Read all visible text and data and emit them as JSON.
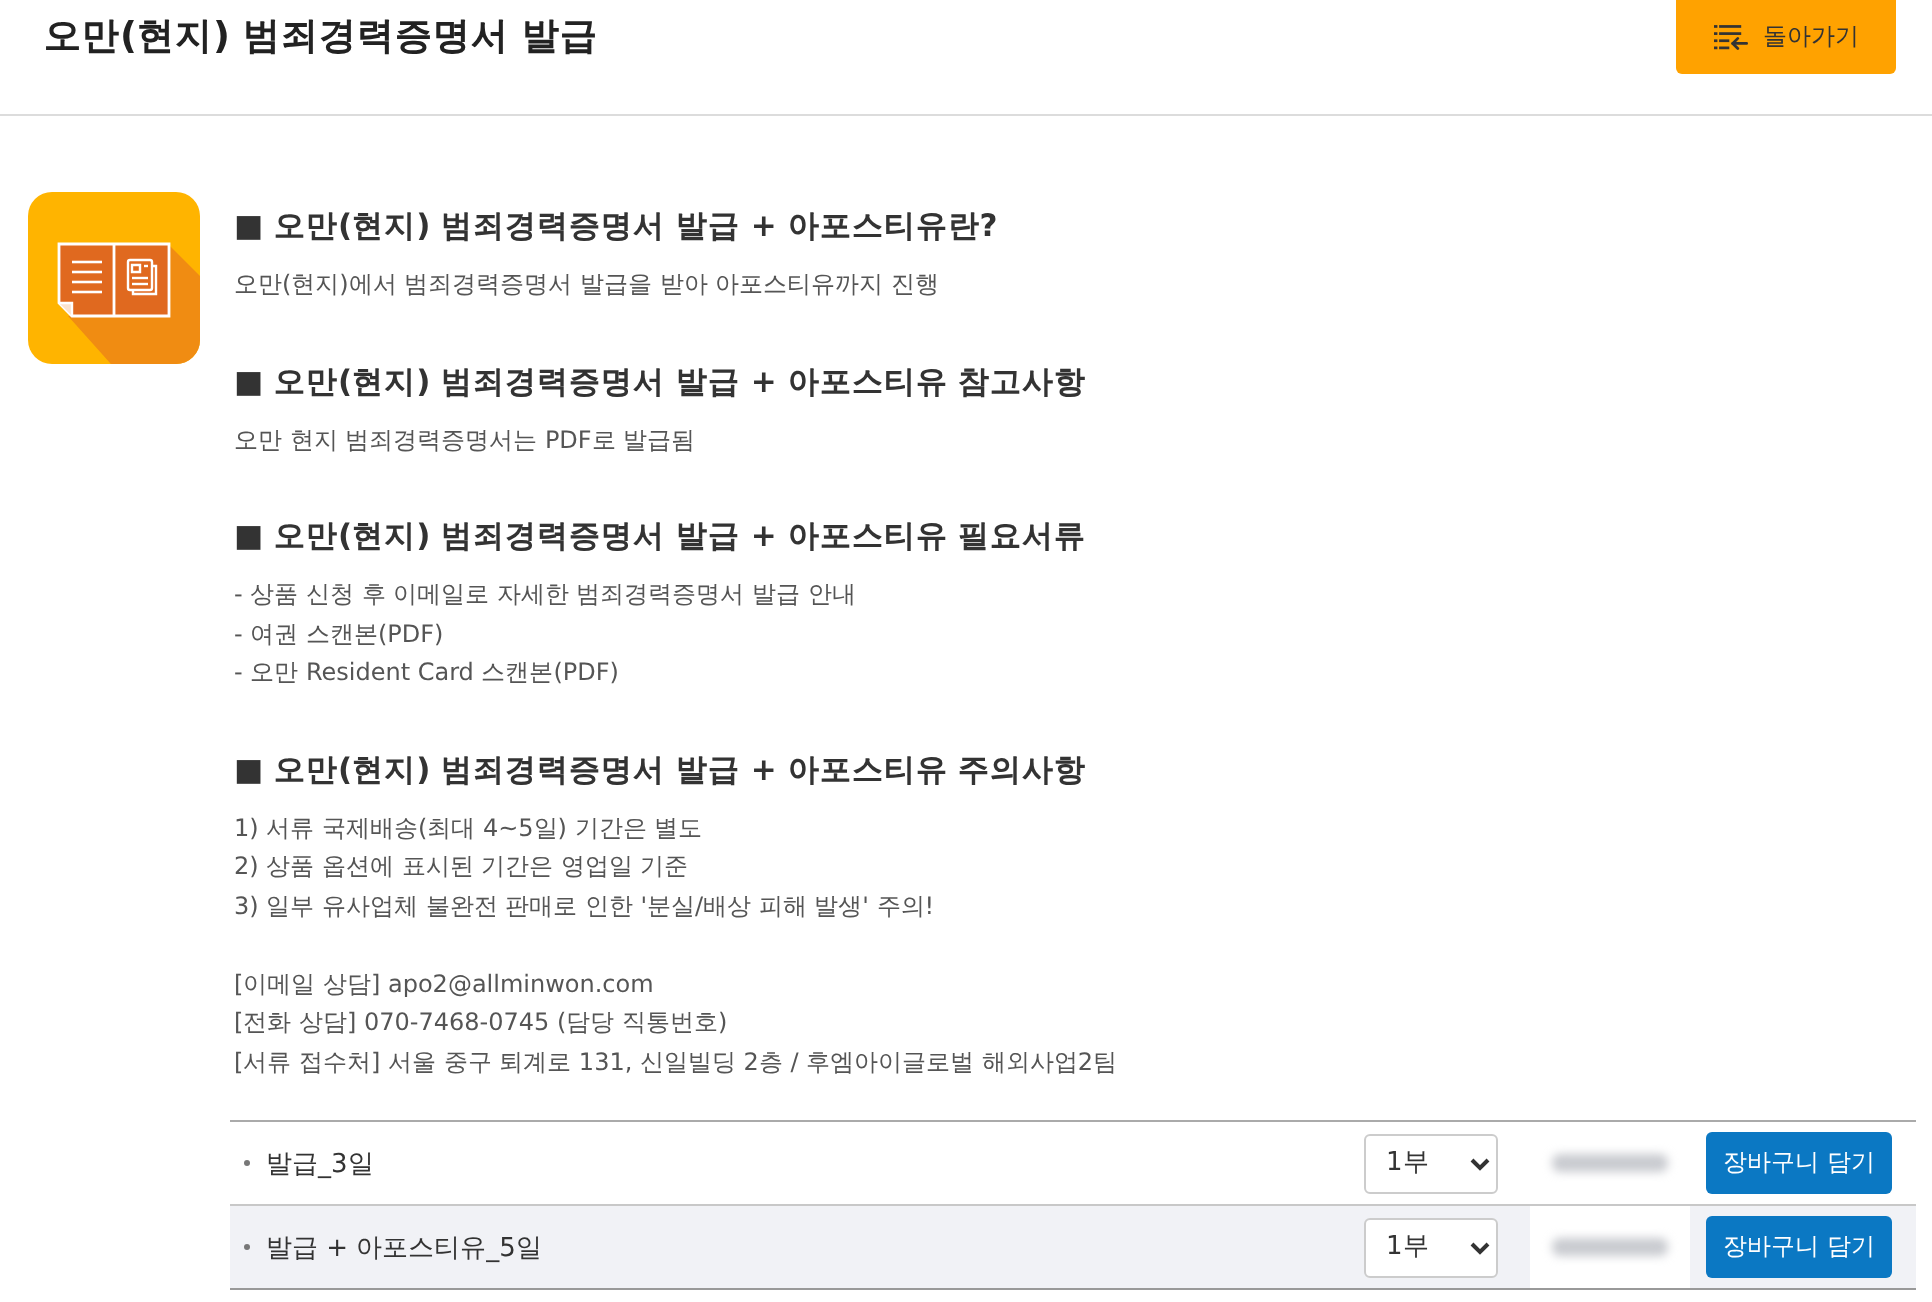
{
  "header": {
    "title": "오만(현지) 범죄경력증명서 발급",
    "back_button": "돌아가기"
  },
  "sections": [
    {
      "heading": "■ 오만(현지) 범죄경력증명서 발급 + 아포스티유란?",
      "paragraphs": [
        [
          "오만(현지)에서 범죄경력증명서 발급을 받아 아포스티유까지 진행"
        ]
      ]
    },
    {
      "heading": "■ 오만(현지) 범죄경력증명서 발급 + 아포스티유 참고사항",
      "paragraphs": [
        [
          "오만 현지 범죄경력증명서는 PDF로 발급됨"
        ]
      ]
    },
    {
      "heading": "■ 오만(현지) 범죄경력증명서 발급 + 아포스티유 필요서류",
      "paragraphs": [
        [
          "- 상품 신청 후 이메일로 자세한 범죄경력증명서 발급 안내",
          "- 여권 스캔본(PDF)",
          "- 오만 Resident Card 스캔본(PDF)"
        ]
      ]
    },
    {
      "heading": "■ 오만(현지) 범죄경력증명서 발급 + 아포스티유 주의사항",
      "paragraphs": [
        [
          "1) 서류 국제배송(최대 4~5일) 기간은 별도",
          "2) 상품 옵션에 표시된 기간은 영업일 기준",
          "3) 일부 유사업체 불완전 판매로 인한 '분실/배상 피해 발생' 주의!"
        ],
        [
          "[이메일 상담] apo2@allminwon.com",
          "[전화 상담] 070-7468-0745 (담당 직통번호)",
          "[서류 접수처] 서울 중구 퇴계로 131, 신일빌딩 2층 / 후엠아이글로벌 해외사업2팀"
        ]
      ]
    }
  ],
  "options": [
    {
      "name": "발급_3일",
      "quantity": "1부",
      "button": "장바구니 담기"
    },
    {
      "name": "발급 + 아포스티유_5일",
      "quantity": "1부",
      "button": "장바구니 담기"
    }
  ]
}
